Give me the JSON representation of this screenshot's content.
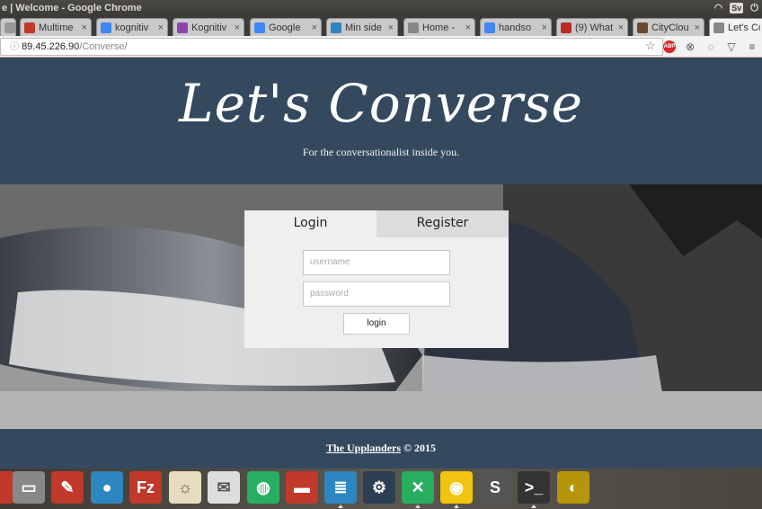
{
  "window": {
    "title": "e | Welcome - Google Chrome",
    "keyboard": "Sv"
  },
  "tabs": [
    {
      "label": "",
      "icon": "unknown-icon",
      "color": "#999999"
    },
    {
      "label": "Multime",
      "icon": "multimedia-icon",
      "color": "#c0392b"
    },
    {
      "label": "kognitiv",
      "icon": "google-icon",
      "color": "#4285f4"
    },
    {
      "label": "Kognitiv",
      "icon": "docs-icon",
      "color": "#8e44ad"
    },
    {
      "label": "Google",
      "icon": "translate-icon",
      "color": "#4285f4"
    },
    {
      "label": "Min side",
      "icon": "wave-icon",
      "color": "#2e86c1"
    },
    {
      "label": "Home - ",
      "icon": "page-icon",
      "color": "#888888"
    },
    {
      "label": "handso",
      "icon": "google-icon",
      "color": "#4285f4"
    },
    {
      "label": "(9) What",
      "icon": "quora-icon",
      "color": "#b92b27"
    },
    {
      "label": "CityClou",
      "icon": "cityclou-icon",
      "color": "#6b4a2e"
    },
    {
      "label": "Let's Co",
      "icon": "page-icon",
      "color": "#888888"
    }
  ],
  "address": {
    "host": "89.45.226.90",
    "path": "/Converse/"
  },
  "site": {
    "brand": "Let's Converse",
    "tagline": "For the conversationalist inside you.",
    "login_tab": "Login",
    "register_tab": "Register",
    "username_placeholder": "username",
    "password_placeholder": "password",
    "login_button": "login",
    "footer_link": "The Upplanders",
    "footer_rest": "© 2015"
  },
  "dock": [
    {
      "name": "red-app-icon",
      "color": "#c0392b"
    },
    {
      "name": "disk-icon",
      "color": "#888888"
    },
    {
      "name": "settings-tool-icon",
      "color": "#c0392b"
    },
    {
      "name": "drop-icon",
      "color": "#2e86c1"
    },
    {
      "name": "filezilla-icon",
      "color": "#c0392b"
    },
    {
      "name": "sun-icon",
      "color": "#e8dcc0"
    },
    {
      "name": "mail-icon",
      "color": "#dddddd"
    },
    {
      "name": "globe-icon",
      "color": "#27ae60"
    },
    {
      "name": "book-icon",
      "color": "#c0392b"
    },
    {
      "name": "writer-icon",
      "color": "#2e86c1"
    },
    {
      "name": "steam-icon",
      "color": "#2c3e50"
    },
    {
      "name": "network-icon",
      "color": "#27ae60"
    },
    {
      "name": "chrome-icon",
      "color": "#f1c40f"
    },
    {
      "name": "sublime-icon",
      "color": "#555555"
    },
    {
      "name": "terminal-icon",
      "color": "#333333"
    },
    {
      "name": "gimp-icon",
      "color": "#b7950b"
    }
  ]
}
